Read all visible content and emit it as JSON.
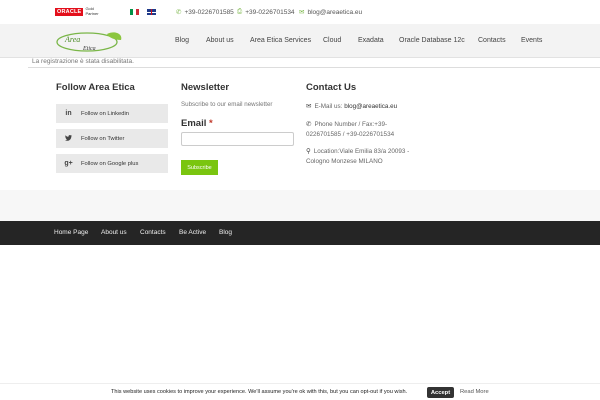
{
  "topbar": {
    "oracle_logo_text": "ORACLE",
    "oracle_partner_line1": "Gold",
    "oracle_partner_line2": "Partner",
    "phone": "+39-0226701585",
    "fax": "+39-0226701534",
    "email": "blog@areaetica.eu"
  },
  "logo": {
    "line1": "Area",
    "line2": "Etica"
  },
  "nav": {
    "items": [
      "Blog",
      "About us",
      "Area Etica Services",
      "Cloud",
      "Exadata",
      "Oracle Database 12c",
      "Contacts",
      "Events"
    ]
  },
  "notice": "La registrazione è stata disabilitata.",
  "follow": {
    "title": "Follow Area Etica",
    "buttons": [
      {
        "icon": "linkedin-icon",
        "label": "Follow on Linkedin"
      },
      {
        "icon": "twitter-icon",
        "label": "Follow on Twitter"
      },
      {
        "icon": "google-plus-icon",
        "label": "Follow on Google plus"
      }
    ]
  },
  "newsletter": {
    "title": "Newsletter",
    "subtitle": "Subscribe to our email newsletter",
    "email_label": "Email",
    "required_mark": "*",
    "email_value": "",
    "subscribe_label": "Subscribe"
  },
  "contact": {
    "title": "Contact Us",
    "email_prefix": "E-Mail us: ",
    "email": "blog@areaetica.eu",
    "phone_line1": "Phone Number / Fax:+39-",
    "phone_line2": "0226701585 / +39-0226701534",
    "location_line1": "Location:Viale Emilia 83/a 20093 -",
    "location_line2": "Cologno Monzese MILANO"
  },
  "footer_nav": {
    "items": [
      "Home Page",
      "About us",
      "Contacts",
      "Be Active",
      "Blog"
    ]
  },
  "cookie": {
    "text": "This website uses cookies to improve your experience. We'll assume you're ok with this, but you can opt-out if you wish.",
    "accept_label": "Accept",
    "read_more_label": "Read More"
  },
  "colors": {
    "accent_green": "#7ac50f",
    "footer_dark": "#252525",
    "oracle_red": "#e30f1b"
  }
}
